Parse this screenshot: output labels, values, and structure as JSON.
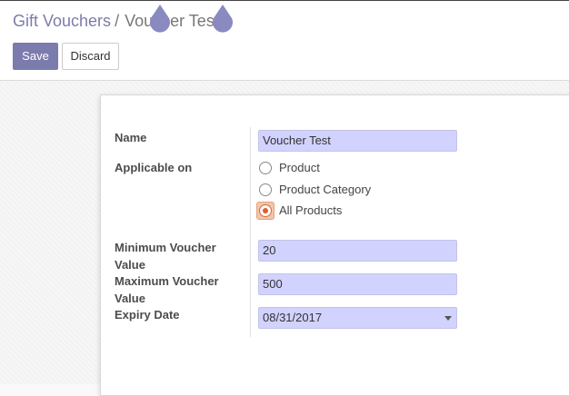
{
  "breadcrumb": {
    "parent": "Gift Vouchers",
    "separator": "/",
    "current": "Voucher Test"
  },
  "toolbar": {
    "save_label": "Save",
    "discard_label": "Discard"
  },
  "form": {
    "name": {
      "label": "Name",
      "value": "Voucher Test"
    },
    "applicable_on": {
      "label": "Applicable on",
      "options": [
        {
          "label": "Product",
          "checked": false
        },
        {
          "label": "Product Category",
          "checked": false
        },
        {
          "label": "All Products",
          "checked": true
        }
      ]
    },
    "min_value": {
      "label_line1": "Minimum Voucher",
      "label_line2": "Value",
      "value": "20"
    },
    "max_value": {
      "label_line1": "Maximum Voucher",
      "label_line2": "Value",
      "value": "500"
    },
    "expiry": {
      "label": "Expiry Date",
      "value": "08/31/2017"
    }
  },
  "colors": {
    "brand": "#7c7bad",
    "input_bg": "#d2d2ff",
    "radio_checked": "#e15c32"
  }
}
